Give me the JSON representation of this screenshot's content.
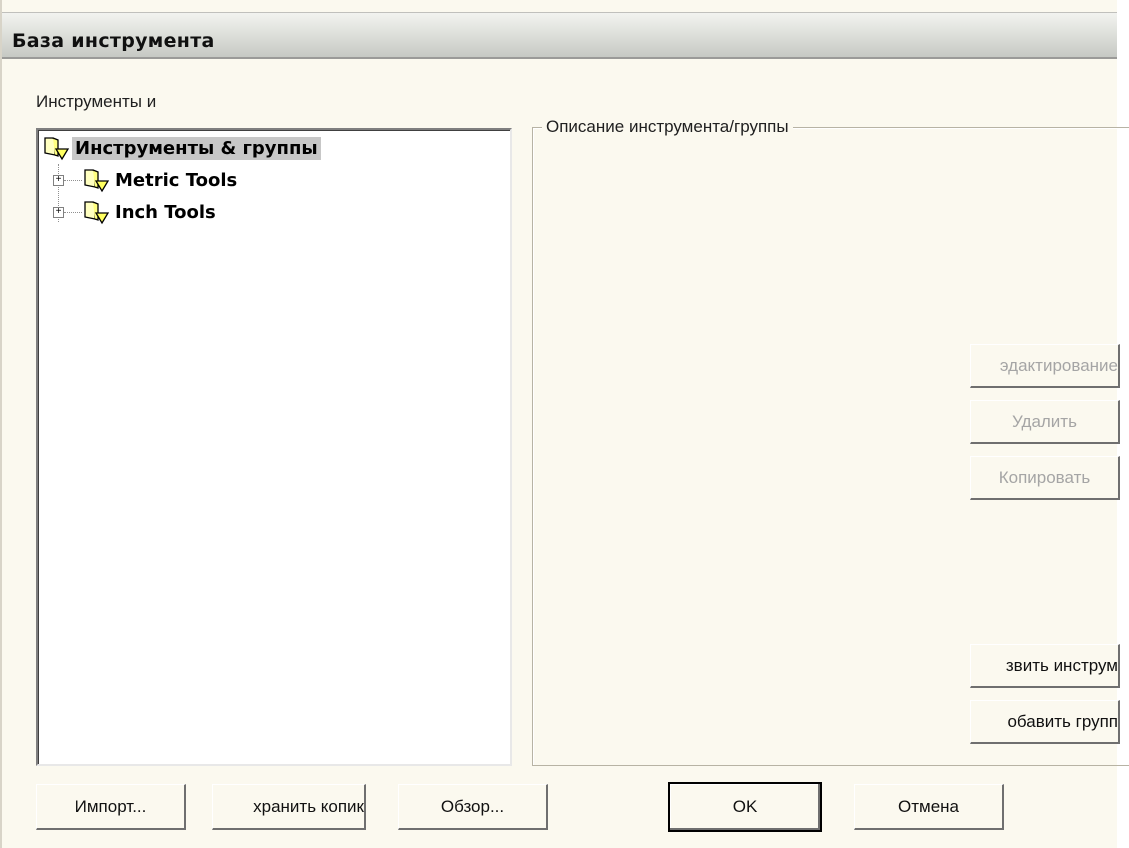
{
  "window": {
    "title": "База инструмента"
  },
  "tools_label": "Инструменты и",
  "tree": {
    "root": "Инструменты & группы",
    "children": [
      {
        "label": "Metric Tools",
        "expander": "+"
      },
      {
        "label": "Inch Tools",
        "expander": "+"
      }
    ]
  },
  "description": {
    "title": "Описание инструмента/группы"
  },
  "side_buttons": {
    "edit": "эдактирование",
    "delete": "Удалить",
    "copy": "Копировать",
    "add_tool": "звить инструм",
    "add_group": "обавить групп"
  },
  "bottom_buttons": {
    "import": "Импорт...",
    "save_copy": "хранить копик",
    "browse": "Обзор...",
    "ok": "OK",
    "cancel": "Отмена"
  },
  "colors": {
    "dialog_bg": "#fbf9ef",
    "selection": "#c7c7c7",
    "disabled_text": "#a5a5a5"
  },
  "icons": {
    "tree_node": "folder-tool-icon"
  }
}
